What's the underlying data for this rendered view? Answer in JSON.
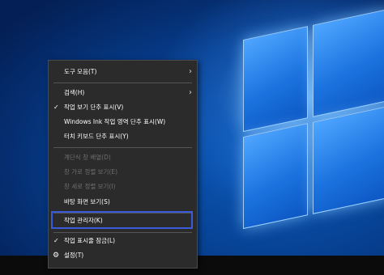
{
  "context_menu": {
    "items": [
      {
        "label": "도구 모음(T)",
        "submenu": true
      },
      {
        "label": "검색(H)",
        "submenu": true
      },
      {
        "label": "작업 보기 단추 표시(V)",
        "checked": true
      },
      {
        "label": "Windows Ink 작업 영역 단추 표시(W)"
      },
      {
        "label": "터치 키보드 단추 표시(Y)"
      },
      {
        "label": "계단식 창 배열(D)",
        "disabled": true
      },
      {
        "label": "창 가로 정렬 보기(E)",
        "disabled": true
      },
      {
        "label": "창 세로 정렬 보기(I)",
        "disabled": true
      },
      {
        "label": "바탕 화면 보기(S)"
      },
      {
        "label": "작업 관리자(K)",
        "highlighted": true
      },
      {
        "label": "작업 표시줄 잠금(L)",
        "checked": true
      },
      {
        "label": "설정(T)",
        "icon": "gear-icon"
      }
    ]
  },
  "colors": {
    "menu_bg": "#2b2b2b",
    "highlight_border": "#3a5bd9",
    "disabled_text": "#6e6e6e"
  }
}
